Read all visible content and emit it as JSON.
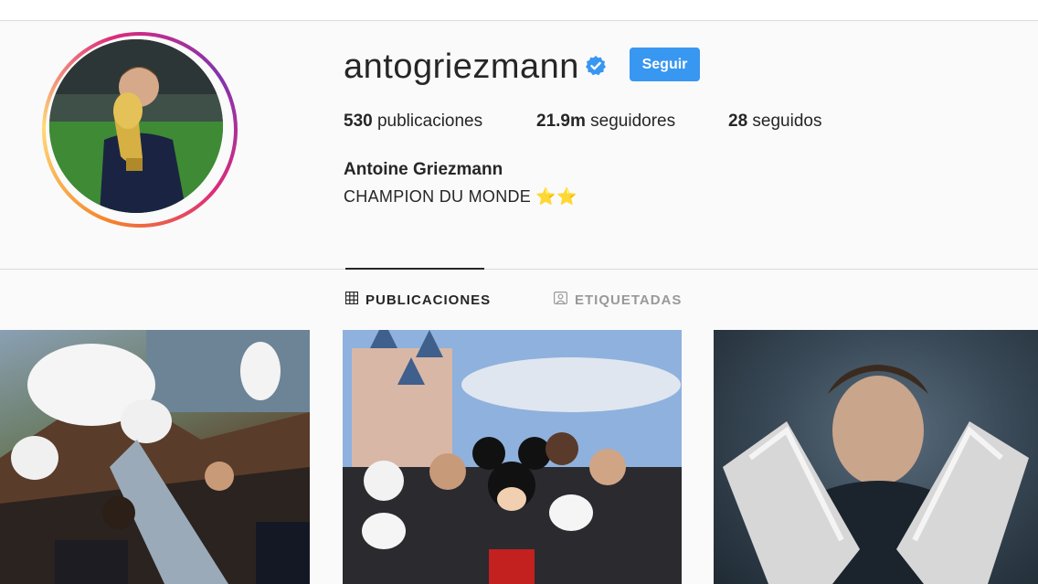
{
  "profile": {
    "username": "antogriezmann",
    "follow_label": "Seguir",
    "full_name": "Antoine Griezmann",
    "bio": "CHAMPION DU MONDE ⭐⭐"
  },
  "stats": {
    "posts_count": "530",
    "posts_label": "publicaciones",
    "followers_count": "21.9m",
    "followers_label": "seguidores",
    "following_count": "28",
    "following_label": "seguidos"
  },
  "tabs": [
    {
      "label": "PUBLICACIONES",
      "icon": "grid-icon",
      "active": true
    },
    {
      "label": "ETIQUETADAS",
      "icon": "tagged-icon",
      "active": false
    }
  ],
  "posts": [
    {
      "image": "disney-ride-photo"
    },
    {
      "image": "mickey-castle-photo"
    },
    {
      "image": "boots-rain-photo"
    }
  ],
  "colors": {
    "accent": "#3897f0",
    "text": "#262626",
    "muted": "#999999",
    "background": "#fafafa"
  }
}
